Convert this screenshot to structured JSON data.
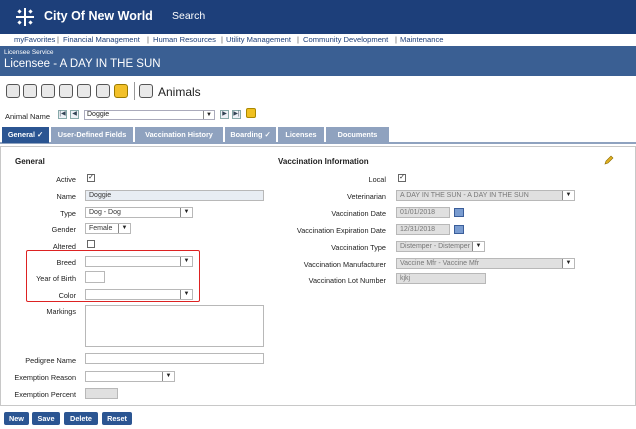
{
  "header": {
    "brand": "City Of New World",
    "search_label": "Search",
    "logo_icon": "snowflake-compass-icon"
  },
  "menu": {
    "items": [
      "myFavorites",
      "Financial Management",
      "Human Resources",
      "Utility Management",
      "Community Development",
      "Maintenance"
    ],
    "separator": "|"
  },
  "title_band": {
    "service": "Licensee Service",
    "title": "Licensee - A DAY IN THE SUN"
  },
  "toolbar": {
    "title": "Animals",
    "icons": [
      "info-icon",
      "copy-icon",
      "refresh-icon",
      "edit-icon",
      "stack-icon",
      "report-icon",
      "smiley-icon",
      "print-icon"
    ]
  },
  "navigator": {
    "label": "Animal Name",
    "value": "Doggie"
  },
  "tabs": [
    {
      "label": "General ✓",
      "active": true
    },
    {
      "label": "User-Defined Fields",
      "active": false
    },
    {
      "label": "Vaccination History",
      "active": false
    },
    {
      "label": "Boarding ✓",
      "active": false
    },
    {
      "label": "Licenses",
      "active": false
    },
    {
      "label": "Documents",
      "active": false
    }
  ],
  "general": {
    "title": "General",
    "active_label": "Active",
    "active_checked": true,
    "name_label": "Name",
    "name_value": "Doggie",
    "type_label": "Type",
    "type_value": "Dog - Dog",
    "gender_label": "Gender",
    "gender_value": "Female",
    "altered_label": "Altered",
    "altered_checked": false,
    "breed_label": "Breed",
    "breed_value": "",
    "yob_label": "Year of Birth",
    "yob_value": "",
    "color_label": "Color",
    "color_value": "",
    "markings_label": "Markings",
    "pedigree_label": "Pedigree Name",
    "exemption_reason_label": "Exemption Reason",
    "exemption_percent_label": "Exemption Percent"
  },
  "vaccination": {
    "title": "Vaccination Information",
    "local_label": "Local",
    "local_checked": true,
    "veterinarian_label": "Veterinarian",
    "veterinarian_value": "A DAY IN THE SUN - A DAY IN THE SUN",
    "vdate_label": "Vaccination Date",
    "vdate_value": "01/01/2018",
    "vexp_label": "Vaccination Expiration Date",
    "vexp_value": "12/31/2018",
    "vtype_label": "Vaccination Type",
    "vtype_value": "Distemper - Distemper",
    "vmfr_label": "Vaccination Manufacturer",
    "vmfr_value": "Vaccine Mfr - Vaccine Mfr",
    "vlot_label": "Vaccination Lot Number",
    "vlot_value": "kjkj"
  },
  "footer": {
    "new": "New",
    "save": "Save",
    "delete": "Delete",
    "reset": "Reset"
  },
  "colors": {
    "header_bg": "#1d3f7a",
    "title_band_bg": "#3a5f93",
    "tab_active": "#2b5592",
    "tab_inactive": "#8fa2bf",
    "highlight": "#dd2222"
  }
}
